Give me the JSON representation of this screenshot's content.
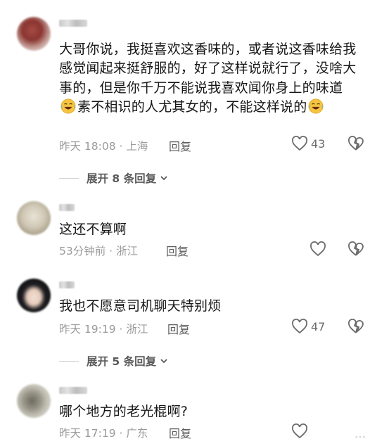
{
  "comments": [
    {
      "text_part1": "大哥你说，我挺喜欢这香味的，或者说这香味给我感觉闻起来挺舒服的，好了这样说就行了，没啥大事的，但是你千万不能说我喜欢闻你身上的味道",
      "text_part2": "素不相识的人尤其女的，不能这样说的",
      "emoji": "laughing-crying-emoji",
      "time": "昨天 18:08 · 上海",
      "reply": "回复",
      "likes": "43"
    },
    {
      "text": "这还不算啊",
      "time": "53分钟前 · 浙江",
      "reply": "回复",
      "likes": ""
    },
    {
      "text": "我也不愿意司机聊天特别烦",
      "time": "昨天 19:19 · 浙江",
      "reply": "回复",
      "likes": "47"
    },
    {
      "text": "哪个地方的老光棍啊?",
      "time": "昨天 17:19 · 广东",
      "reply": "回复",
      "likes": ""
    }
  ],
  "expand_1": "展开 8 条回复",
  "expand_2": "展开 5 条回复",
  "icons": {
    "like": "heart-outline-icon",
    "dislike": "broken-heart-icon",
    "expand": "chevron-down-icon"
  },
  "colors": {
    "text": "#161616",
    "meta": "#9b9b9b",
    "reply": "#5d5d5d",
    "emoji": "#f5c542"
  }
}
